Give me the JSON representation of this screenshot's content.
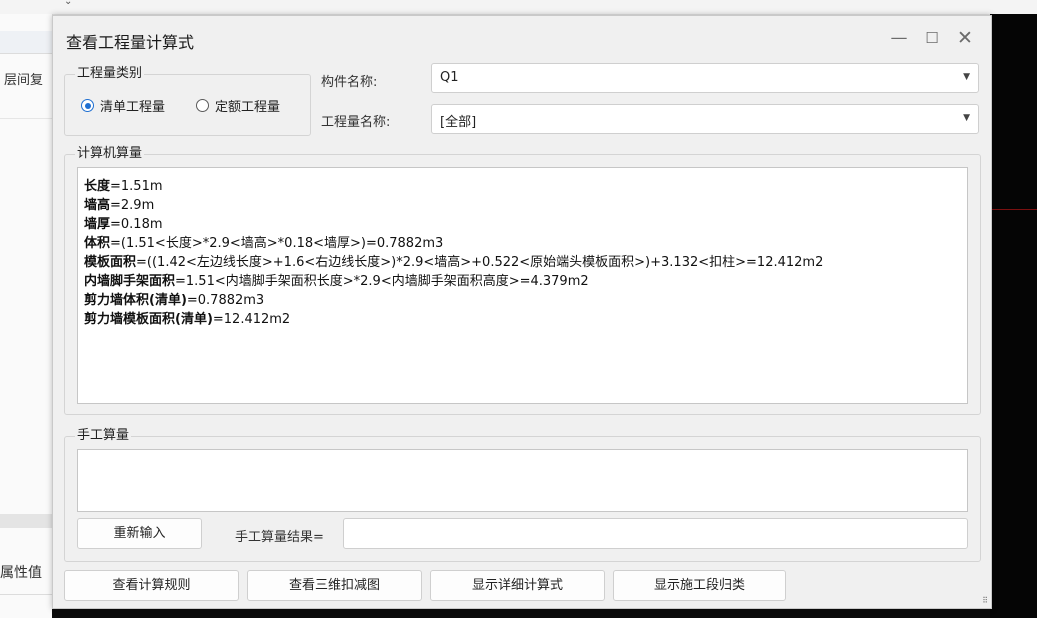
{
  "background": {
    "left_tab_fragment": "层间复",
    "left_property_fragment": "属性值"
  },
  "dialog": {
    "title": "查看工程量计算式",
    "window_controls": {
      "minimize": "—",
      "maximize": "☐",
      "close": "✕"
    },
    "quantity_type": {
      "legend": "工程量类别",
      "options": [
        {
          "label": "清单工程量",
          "checked": true
        },
        {
          "label": "定额工程量",
          "checked": false
        }
      ]
    },
    "component_name": {
      "label": "构件名称:",
      "value": "Q1"
    },
    "quantity_name": {
      "label": "工程量名称:",
      "value": "[全部]"
    },
    "computer_calc": {
      "legend": "计算机算量",
      "lines": [
        {
          "key": "长度",
          "value": "=1.51m"
        },
        {
          "key": "墙高",
          "value": "=2.9m"
        },
        {
          "key": "墙厚",
          "value": "=0.18m"
        },
        {
          "key": "体积",
          "value": "=(1.51<长度>*2.9<墙高>*0.18<墙厚>)=0.7882m3"
        },
        {
          "key": "模板面积",
          "value": "=((1.42<左边线长度>+1.6<右边线长度>)*2.9<墙高>+0.522<原始端头模板面积>)+3.132<扣柱>=12.412m2"
        },
        {
          "key": "内墙脚手架面积",
          "value": "=1.51<内墙脚手架面积长度>*2.9<内墙脚手架面积高度>=4.379m2"
        },
        {
          "key": "剪力墙体积(清单)",
          "value": "=0.7882m3"
        },
        {
          "key": "剪力墙模板面积(清单)",
          "value": "=12.412m2"
        }
      ]
    },
    "manual_calc": {
      "legend": "手工算量",
      "reenter_button": "重新输入",
      "result_label": "手工算量结果=",
      "result_value": ""
    },
    "buttons": {
      "view_rules": "查看计算规则",
      "view_3d": "查看三维扣减图",
      "show_detail": "显示详细计算式",
      "show_stage": "显示施工段归类"
    },
    "resize_grip": "⠿"
  }
}
